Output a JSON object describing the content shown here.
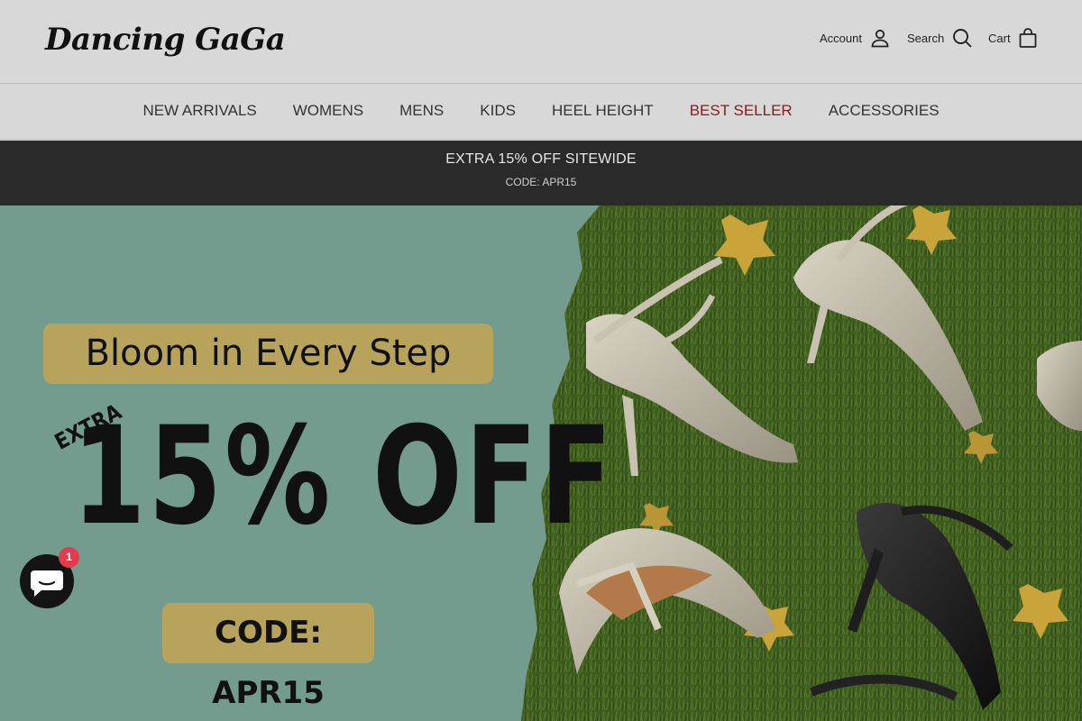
{
  "brand": {
    "logo": "Dancing GaGa"
  },
  "header": {
    "account_label": "Account",
    "search_label": "Search",
    "cart_label": "Cart"
  },
  "nav": {
    "items": [
      {
        "label": "NEW ARRIVALS"
      },
      {
        "label": "WOMENS"
      },
      {
        "label": "MENS"
      },
      {
        "label": "KIDS"
      },
      {
        "label": "HEEL HEIGHT"
      },
      {
        "label": "BEST SELLER",
        "color": "#8a1a1a"
      },
      {
        "label": "ACCESSORIES"
      }
    ]
  },
  "promo_bar": {
    "title": "EXTRA 15% OFF SITEWIDE",
    "code": "CODE: APR15"
  },
  "hero": {
    "headline": "Bloom in Every Step",
    "extra": "EXTRA",
    "discount": "15% OFF",
    "code": "CODE: APR15",
    "colors": {
      "panel": "#749c8e",
      "pill": "#b8a35c",
      "grass": "#3d5a1e"
    }
  },
  "chat": {
    "badge_count": "1"
  }
}
